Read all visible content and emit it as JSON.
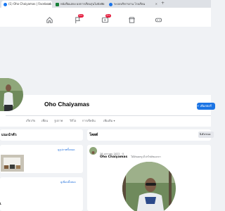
{
  "browser": {
    "tabs": [
      {
        "label": "(1) Oho Chaiyamas | Facebook",
        "active": true,
        "color": "#1877f2"
      },
      {
        "label": "หนังสือแสดง ผลการเรียนรุ่นไม่บังคับ",
        "active": false,
        "color": "#188038"
      },
      {
        "label": "ระบบบริหารงาน โรงเรียน",
        "active": false,
        "color": "#1a73e8"
      }
    ]
  },
  "nav": {
    "icons": [
      "home-icon",
      "flag-icon",
      "play-icon",
      "store-icon",
      "gaming-icon"
    ],
    "badges": {
      "flag": "9+",
      "video": "9+"
    }
  },
  "profile": {
    "name": "Oho Chaiyamas",
    "add_story_label": "+ เพิ่มสตอรี่"
  },
  "tabs": [
    "เกี่ยวกับ",
    "เพื่อน",
    "รูปภาพ",
    "วิดีโอ",
    "การเช็คอิน",
    "เพิ่มเติม ▾"
  ],
  "left": {
    "intro_title": "แนะนำตัว",
    "photos_link": "ดูรูปภาพทั้งหมด",
    "friends_link": "ดูเพื่อนทั้งหมด",
    "bottom_label": "เ"
  },
  "feed": {
    "posts_title": "โพสต์",
    "filter_label": "ตัวกรอง",
    "post_name": "Oho Chaiyamas",
    "post_action": "ได้อัพเดตรูปโปรไฟล์ของเขา",
    "post_date": "28 มกราคม 2022 · ⚲"
  }
}
